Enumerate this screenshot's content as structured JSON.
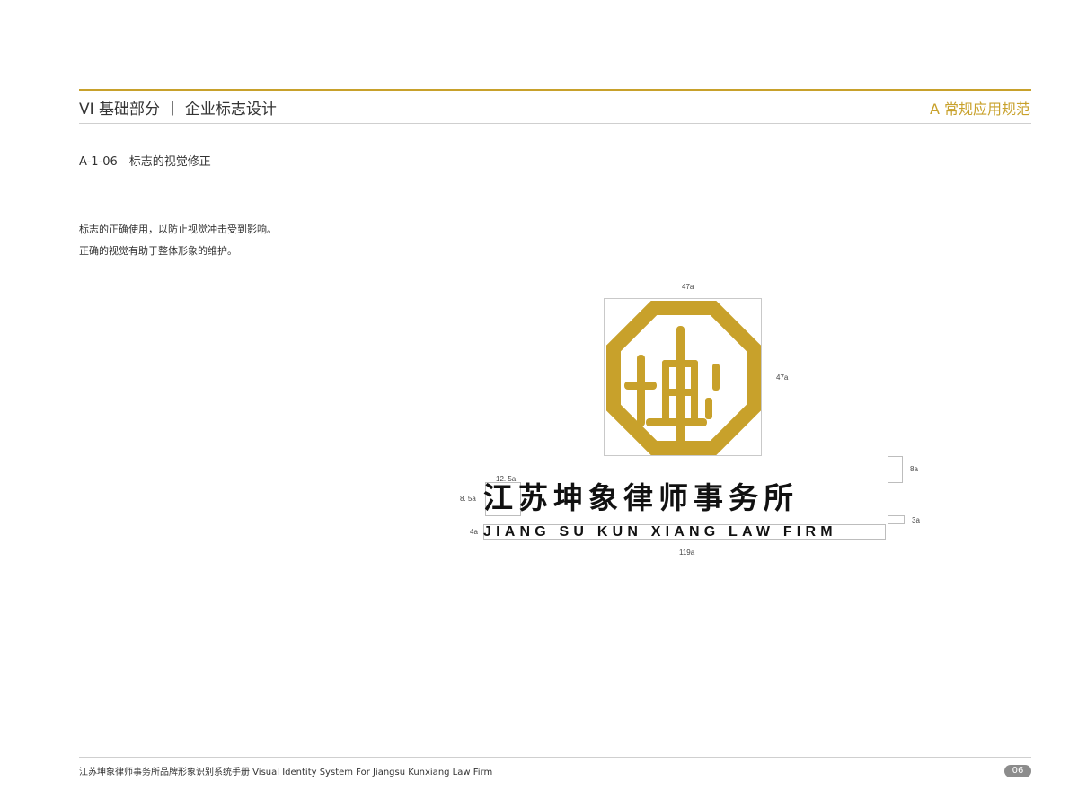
{
  "header": {
    "section_title": "VI 基础部分 丨 企业标志设计",
    "section_right": "A 常规应用规范"
  },
  "content": {
    "item_code": "A-1-06　标志的视觉修正",
    "description_lines": [
      "标志的正确使用，以防止视觉冲击受到影响。",
      "正确的视觉有助于整体形象的维护。"
    ]
  },
  "logo": {
    "emblem_glyph": "坤",
    "emblem_color": "#c8a12b",
    "brand_name_cn": "江苏坤象律师事务所",
    "brand_name_en": "JIANG SU KUN XIANG LAW FIRM"
  },
  "dimensions": {
    "emblem_width": "47a",
    "emblem_height": "47a",
    "gap_emblem_to_name": "8a",
    "char_width": "12. 5a",
    "char_height": "8. 5a",
    "gap_name_to_english": "3a",
    "english_height": "4a",
    "total_width": "119a"
  },
  "footer": {
    "text": "江苏坤象律师事务所品牌形象识别系统手册  Visual Identity System For Jiangsu Kunxiang Law Firm",
    "page_number": "06"
  },
  "colors": {
    "accent_gold": "#c8a12b",
    "rule_grey": "#cfcfcf",
    "badge_grey": "#8c8c8c"
  }
}
